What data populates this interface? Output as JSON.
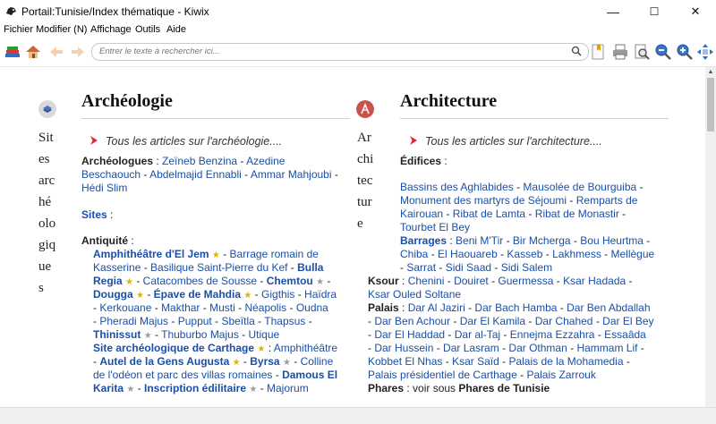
{
  "window": {
    "title": "Portail:Tunisie/Index thématique - Kiwix",
    "min": "—",
    "max": "☐",
    "close": "✕"
  },
  "menu": [
    "Fichier",
    "Modifier (N)",
    "Affichage",
    "Outils",
    "Aide"
  ],
  "search": {
    "placeholder": "Entrer le texte à rechercher ici..."
  },
  "left": {
    "title": "Archéologie",
    "vertical": [
      "Sit",
      "es",
      "arc",
      "hé",
      "olo",
      "giq",
      "ue",
      "s"
    ],
    "tous": "Tous les articles sur l'archéologie....",
    "l1_label": "Archéologues",
    "l1_sep": " : ",
    "l1_a": "Zeïneb Benzina",
    "l1_b": "Azedine",
    "l2_a": "Beschaouch",
    "l2_b": "Abdelmajid Ennabli",
    "l2_c": "Ammar Mahjoubi",
    "l3_a": "Hédi Slim",
    "sites": "Sites",
    "sites_colon": " :",
    "antiq": "Antiquité",
    "antiq_colon": " :",
    "r1_a": "Amphithéâtre d'El Jem",
    "r1_b": "Barrage romain de",
    "r2_a": "Kasserine",
    "r2_b": "Basilique Saint-Pierre du Kef",
    "r2_c": "Bulla",
    "r3_a": "Regia",
    "r3_b": "Catacombes de Sousse",
    "r3_c": "Chemtou",
    "r4_a": "Dougga",
    "r4_b": "Épave de Mahdia",
    "r4_c": "Gigthis",
    "r4_d": "Haïdra",
    "r5_a": "Kerkouane",
    "r5_b": "Makthar",
    "r5_c": "Musti",
    "r5_d": "Néapolis",
    "r5_e": "Oudna",
    "r6_a": "Pheradi Majus",
    "r6_b": "Pupput",
    "r6_c": "Sbeïtla",
    "r6_d": "Thapsus",
    "r7_a": "Thinissut",
    "r7_b": "Thuburbo Majus",
    "r7_c": "Utique",
    "r8_a": "Site archéologique de Carthage",
    "r8_b": "Amphithéâtre",
    "r9_a": "Autel de la Gens Augusta",
    "r9_b": "Byrsa",
    "r9_c": "Colline",
    "r10_a": "de l'odéon et parc des villas romaines",
    "r10_b": "Damous El",
    "r11_a": "Karita",
    "r11_b": "Inscription édilitaire",
    "r11_c": "Majorum"
  },
  "right": {
    "title": "Architecture",
    "vertical": [
      "Ar",
      "chi",
      "tec",
      "tur",
      "e"
    ],
    "tous": "Tous les articles sur l'architecture....",
    "edifices": "Édifices",
    "edifices_colon": " :",
    "a1_a": "Bassins des Aghlabides",
    "a1_b": "Mausolée de Bourguiba",
    "a2_a": "Monument des martyrs de Séjoumi",
    "a2_b": "Remparts de",
    "a3_a": "Kairouan",
    "a3_b": "Ribat de Lamta",
    "a3_c": "Ribat de Monastir",
    "a4_a": "Tourbet El Bey",
    "b1_label": "Barrages",
    "b1_sep": " : ",
    "b1_a": "Beni M'Tir",
    "b1_b": "Bir Mcherga",
    "b1_c": "Bou Heurtma",
    "b2_a": "Chiba",
    "b2_b": "El Haouareb",
    "b2_c": "Kasseb",
    "b2_d": "Lakhmess",
    "b2_e": "Mellègue",
    "b3_a": "Sarrat",
    "b3_b": "Sidi Saad",
    "b3_c": "Sidi Salem",
    "k1_label": "Ksour",
    "k1_sep": " : ",
    "k1_a": "Chenini",
    "k1_b": "Douiret",
    "k1_c": "Guermessa",
    "k1_d": "Ksar Hadada",
    "k2_a": "Ksar Ouled Soltane",
    "p1_label": "Palais",
    "p1_sep": " : ",
    "p1_a": "Dar Al Jaziri",
    "p1_b": "Dar Bach Hamba",
    "p1_c": "Dar Ben Abdallah",
    "p2_a": "Dar Ben Achour",
    "p2_b": "Dar El Kamila",
    "p2_c": "Dar Chahed",
    "p2_d": "Dar El Bey",
    "p3_a": "Dar El Haddad",
    "p3_b": "Dar al-Taj",
    "p3_c": "Ennejma Ezzahra",
    "p3_d": "Essaâda",
    "p4_a": "Dar Hussein",
    "p4_b": "Dar Lasram",
    "p4_c": "Dar Othman",
    "p4_d": "Hammam Lif",
    "p5_a": "Kobbet El Nhas",
    "p5_b": "Ksar Saïd",
    "p5_c": "Palais de la Mohamedia",
    "p6_a": "Palais présidentiel de Carthage",
    "p6_b": "Palais Zarrouk",
    "ph_label": "Phares",
    "ph_text": " : voir sous ",
    "ph_link": "Phares de Tunisie"
  },
  "colors": {
    "link": "#1a4fa8",
    "arrow": "#e3262b",
    "gold_star": "#e0b300",
    "silver_star": "#9c9c9c"
  }
}
